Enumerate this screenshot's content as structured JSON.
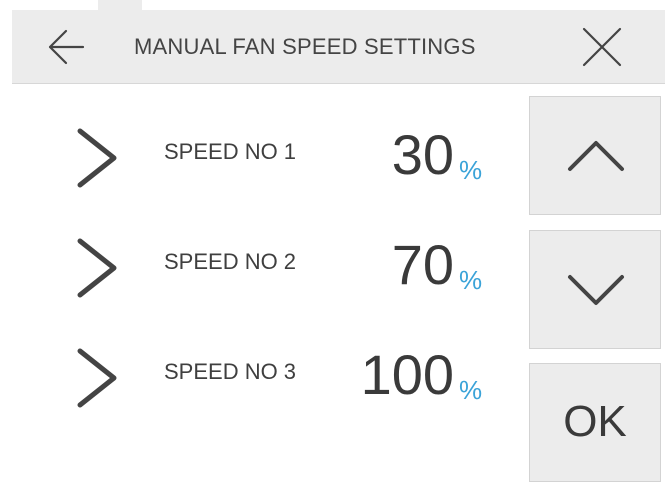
{
  "header": {
    "title": "MANUAL FAN SPEED SETTINGS",
    "back_icon": "arrow-left-icon",
    "close_icon": "close-icon"
  },
  "speeds": [
    {
      "label": "SPEED NO 1",
      "value": "30",
      "unit": "%"
    },
    {
      "label": "SPEED NO 2",
      "value": "70",
      "unit": "%"
    },
    {
      "label": "SPEED NO 3",
      "value": "100",
      "unit": "%"
    }
  ],
  "controls": {
    "up_icon": "chevron-up-icon",
    "down_icon": "chevron-down-icon",
    "ok_label": "OK"
  },
  "colors": {
    "accent": "#3ba3d8",
    "panel": "#ececec",
    "text": "#3a3a3a"
  }
}
